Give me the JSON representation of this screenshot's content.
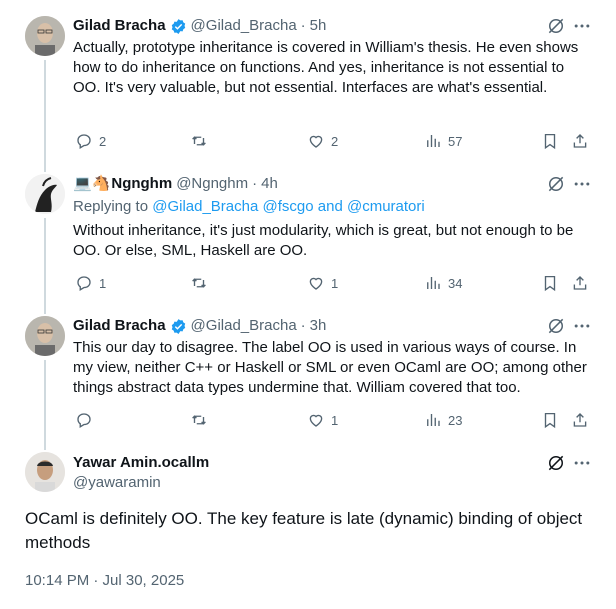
{
  "tweets": [
    {
      "name": "Gilad Bracha",
      "handle": "@Gilad_Bracha",
      "sep": "·",
      "time": "5h",
      "text": "Actually, prototype inheritance is covered in William's thesis.  He even shows how to do inheritance on functions. And yes, inheritance is not essential to OO. It's very valuable, but not essential. Interfaces are what's essential.",
      "replies": "2",
      "retweets": "",
      "likes": "2",
      "views": "57"
    },
    {
      "name_emoji": "💻🐴",
      "name": "Ngnghm",
      "handle": "@Ngnghm",
      "sep": "·",
      "time": "4h",
      "replying_prefix": "Replying to ",
      "replying_handles": "@Gilad_Bracha @fscgo",
      "replying_and": " and ",
      "replying_last": "@cmuratori",
      "text": "Without inheritance, it's just modularity, which is great, but not enough to be OO. Or else, SML, Haskell are OO.",
      "replies": "1",
      "retweets": "",
      "likes": "1",
      "views": "34"
    },
    {
      "name": "Gilad Bracha",
      "handle": "@Gilad_Bracha",
      "sep": "·",
      "time": "3h",
      "text": "This our day to disagree.  The label OO is used in various ways of course. In my view, neither C++ or Haskell or SML or even OCaml are OO; among other things abstract data types undermine that. William covered that too.",
      "replies": "",
      "retweets": "",
      "likes": "1",
      "views": "23"
    }
  ],
  "main": {
    "name": "Yawar Amin.ocallm",
    "handle": "@yawaramin",
    "text": "OCaml is definitely OO. The key feature is late (dynamic) binding of object methods",
    "timestamp": "10:14 PM · Jul 30, 2025"
  },
  "icons": {
    "verified": "verified-badge-icon",
    "grok": "grok-icon",
    "more": "more-icon",
    "reply": "reply-icon",
    "retweet": "retweet-icon",
    "like": "like-icon",
    "views": "views-icon",
    "bookmark": "bookmark-icon",
    "share": "share-icon"
  },
  "colors": {
    "text": "#0f1419",
    "secondary": "#536471",
    "link": "#1d9bf0",
    "thread_line": "#cfd9de"
  }
}
